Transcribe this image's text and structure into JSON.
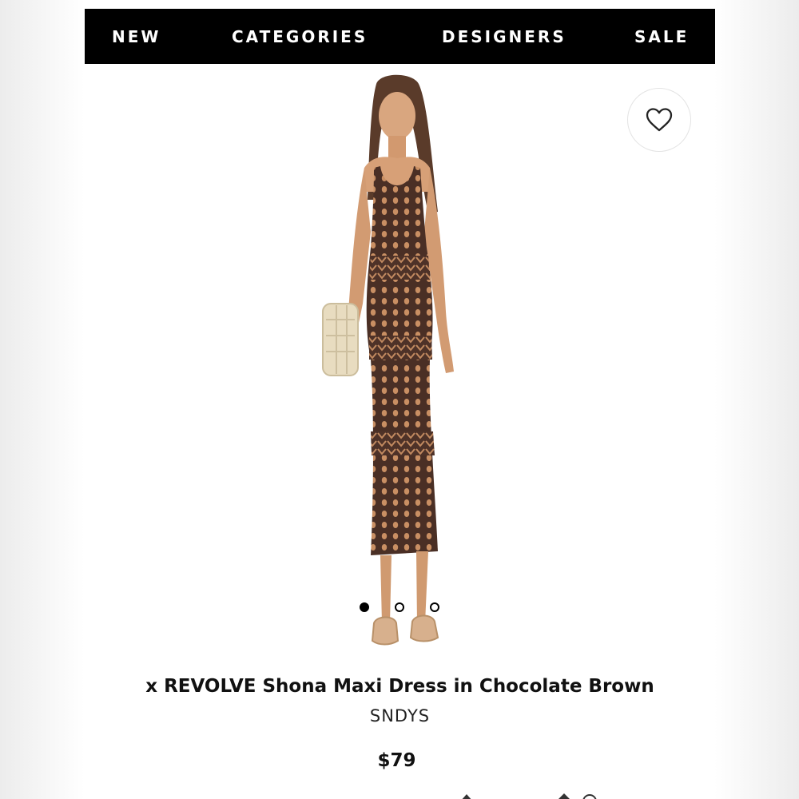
{
  "nav": {
    "items": [
      {
        "label": "NEW"
      },
      {
        "label": "CATEGORIES"
      },
      {
        "label": "DESIGNERS"
      },
      {
        "label": "SALE"
      }
    ]
  },
  "product": {
    "title": "x REVOLVE Shona Maxi Dress in Chocolate Brown",
    "brand": "SNDYS",
    "price": "$79",
    "image_count": 3,
    "active_image_index": 0,
    "dress_color": "#4a2f25",
    "favorite_icon": "heart-outline-icon"
  },
  "colors": {
    "nav_background": "#000000",
    "nav_text": "#ffffff",
    "text_primary": "#111111"
  }
}
